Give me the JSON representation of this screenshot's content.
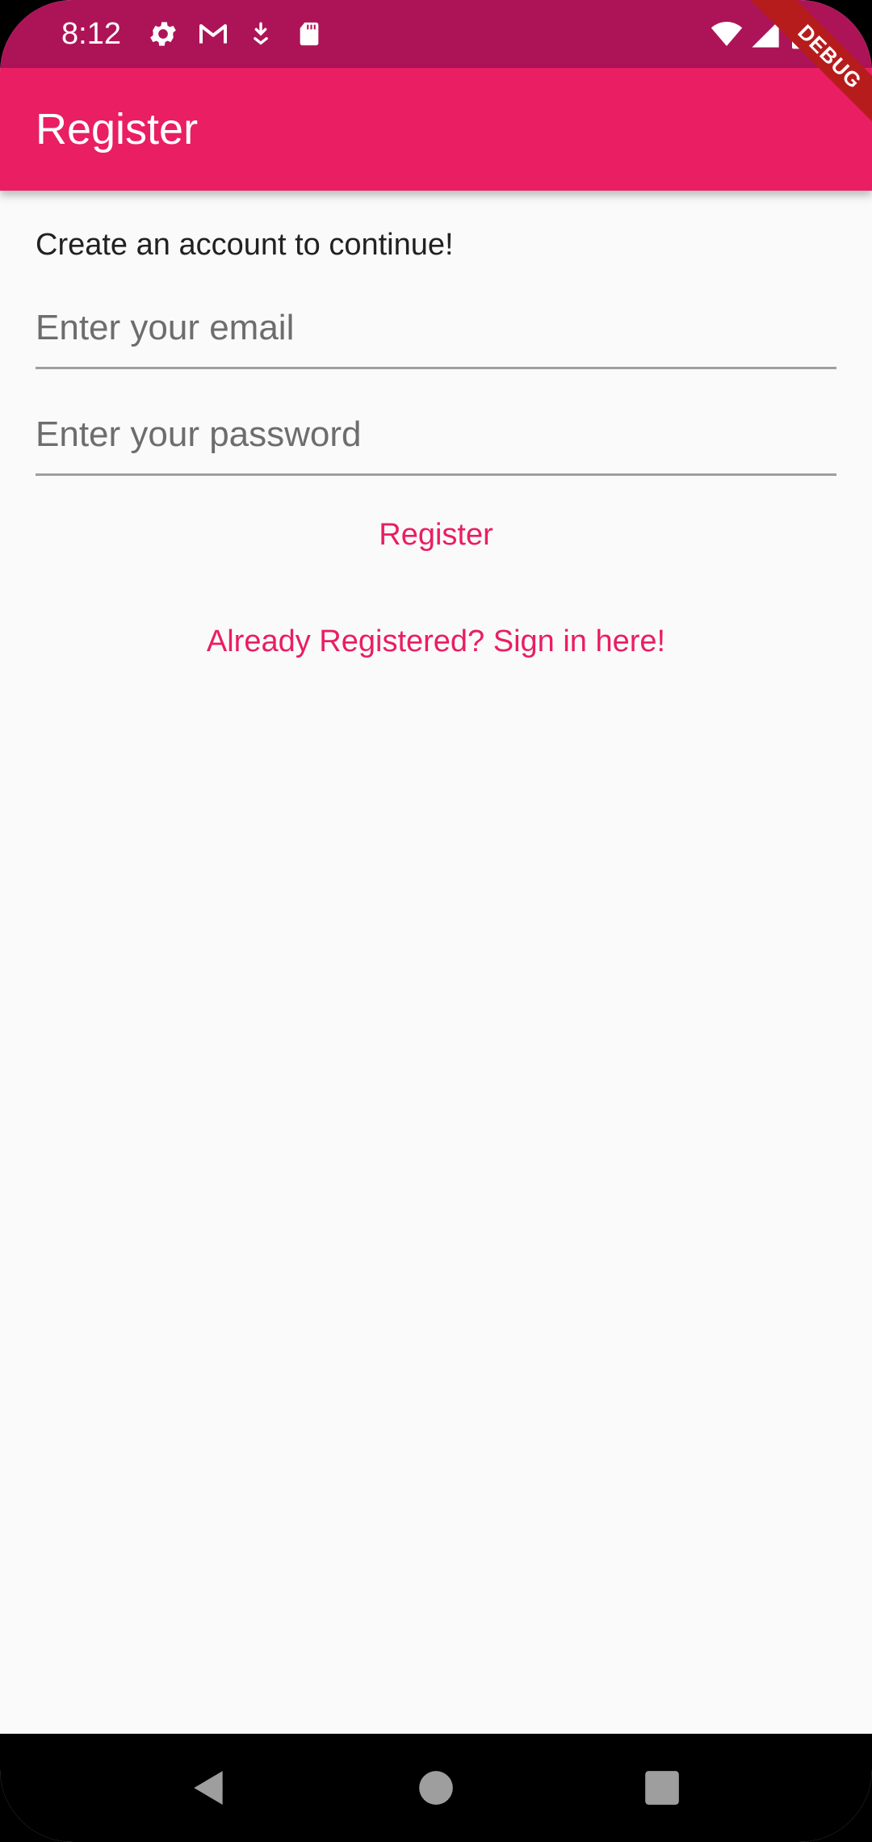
{
  "status_bar": {
    "time": "8:12",
    "icons": [
      "settings-icon",
      "gmail-icon",
      "download-icon",
      "sd-card-icon",
      "wifi-icon",
      "signal-icon",
      "battery-icon"
    ]
  },
  "app_bar": {
    "title": "Register"
  },
  "debug_banner": {
    "label": "DEBUG"
  },
  "form": {
    "subtitle": "Create an account to continue!",
    "email_placeholder": "Enter your email",
    "email_value": "",
    "password_placeholder": "Enter your password",
    "password_value": "",
    "register_label": "Register",
    "signin_label": "Already Registered? Sign in here!"
  },
  "nav_bar": {
    "buttons": [
      "back-icon",
      "home-icon",
      "recents-icon"
    ]
  },
  "colors": {
    "primary": "#e91e63",
    "primary_dark": "#ad1457",
    "background": "#fafafa"
  }
}
